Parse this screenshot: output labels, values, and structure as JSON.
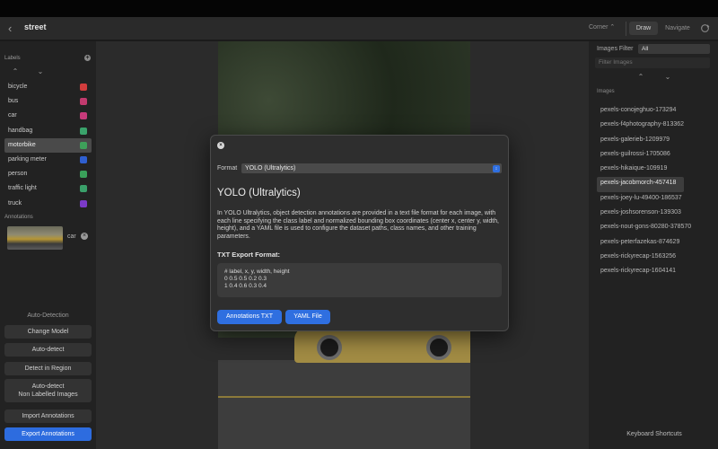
{
  "titlebar": {
    "title": "street",
    "mode": "Corner ⌃",
    "tabs": [
      {
        "label": "Draw"
      },
      {
        "label": "Navigate"
      }
    ]
  },
  "left": {
    "labels_title": "Labels",
    "labels": [
      {
        "name": "bicycle",
        "color": "#d13c3c"
      },
      {
        "name": "bus",
        "color": "#c23a6e"
      },
      {
        "name": "car",
        "color": "#c73a7a"
      },
      {
        "name": "handbag",
        "color": "#3aa36b"
      },
      {
        "name": "motorbike",
        "color": "#3ea05a",
        "selected": true
      },
      {
        "name": "parking meter",
        "color": "#2f5fd0"
      },
      {
        "name": "person",
        "color": "#3aa05a"
      },
      {
        "name": "traffic light",
        "color": "#3aa06a"
      },
      {
        "name": "truck",
        "color": "#7b3ac8"
      }
    ],
    "annotations_title": "Annotations",
    "annotation": {
      "label": "car"
    },
    "auto_detection_title": "Auto-Detection",
    "buttons": {
      "change_model": "Change Model",
      "auto_detect": "Auto-detect",
      "detect_region": "Detect in Region",
      "auto_detect_non_1": "Auto-detect",
      "auto_detect_non_2": "Non Labelled Images",
      "import": "Import Annotations",
      "export": "Export Annotations"
    }
  },
  "right": {
    "images_filter_label": "Images Filter",
    "filter_value": "All",
    "filter_placeholder": "Filter Images",
    "images_title": "Images",
    "images": [
      {
        "name": "pexels-conojeghuo-173294"
      },
      {
        "name": "pexels-f4photography-813362"
      },
      {
        "name": "pexels-galerieb-1209979"
      },
      {
        "name": "pexels-guilrossi-1705086"
      },
      {
        "name": "pexels-hikaique-109919"
      },
      {
        "name": "pexels-jacobmorch-457418",
        "selected": true
      },
      {
        "name": "pexels-joey-lu-49400-186537"
      },
      {
        "name": "pexels-joshsorenson-139303"
      },
      {
        "name": "pexels-nout-gons-80280-378570"
      },
      {
        "name": "pexels-peterfazekas-874629"
      },
      {
        "name": "pexels-rickyrecap-1563256"
      },
      {
        "name": "pexels-rickyrecap-1604141"
      }
    ],
    "keyboard_shortcuts": "Keyboard Shortcuts"
  },
  "modal": {
    "format_label": "Format",
    "format_value": "YOLO (Ultralytics)",
    "title": "YOLO (Ultralytics)",
    "description": "In YOLO Ultralytics, object detection annotations are provided in a text file format for each image, with each line specifying the class label and normalized bounding box coordinates (center x, center y, width, height), and a YAML file is used to configure the dataset paths, class names, and other training parameters.",
    "subtitle": "TXT Export Format:",
    "code_lines": [
      "# label, x, y, width, height",
      "0 0.5 0.5 0.2 0.3",
      "1 0.4 0.6 0.3 0.4"
    ],
    "btn_txt": "Annotations TXT",
    "btn_yaml": "YAML File"
  }
}
